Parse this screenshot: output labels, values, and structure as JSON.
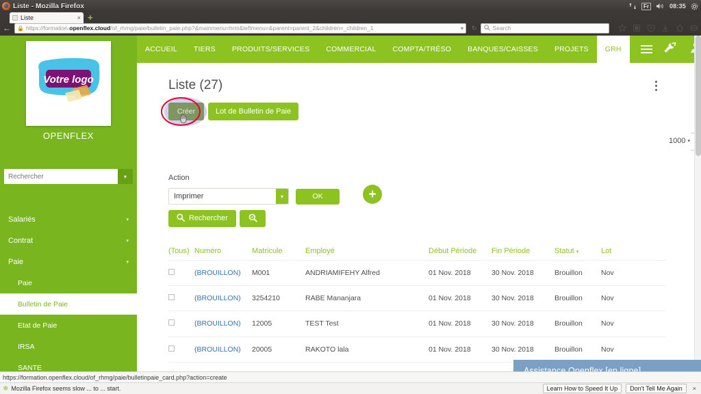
{
  "os": {
    "window_title": "Liste - Mozilla Firefox",
    "tray": {
      "network_icon": "network-icon",
      "keyboard_layout": "Fr",
      "volume_icon": "volume-icon",
      "clock": "08:35",
      "settings_icon": "gear-icon"
    }
  },
  "browser": {
    "tab": {
      "title": "Liste",
      "close_label": "×",
      "favicon": "page-icon"
    },
    "new_tab_label": "+",
    "back_label": "←",
    "url": {
      "lock_icon": "lock-icon",
      "prefix": "https://formation.",
      "domain": "openflex.cloud",
      "path": "/of_rhmg/paie/bulletin_paie.php?&mainmenu=hrm&leftmenu=&parent=parent_2&children=_children_1",
      "dropdown_label": "▾",
      "reload_label": "↻"
    },
    "search": {
      "placeholder": "Search",
      "icon": "search-icon"
    },
    "toolbar_icons": [
      "bookmark-star-icon",
      "library-icon",
      "pocket-icon",
      "downloads-icon",
      "home-icon",
      "account-icon",
      "hamburger-menu-icon"
    ]
  },
  "sidebar": {
    "logo": {
      "alt": "Votre logo",
      "text": "Votre logo"
    },
    "brand": "OPENFLEX",
    "search": {
      "placeholder": "Rechercher",
      "value": "",
      "button_icon": "chevron-down-icon"
    },
    "items": [
      {
        "label": "Salariés",
        "caret": "▾",
        "type": "group",
        "active": false
      },
      {
        "label": "Contrat",
        "caret": "▾",
        "type": "group",
        "active": false
      },
      {
        "label": "Paie",
        "caret": "▾",
        "type": "group",
        "active": false
      },
      {
        "label": "Paie",
        "type": "sub",
        "active": false
      },
      {
        "label": "Bulletin de Paie",
        "type": "sub",
        "active": true
      },
      {
        "label": "Etat de Paie",
        "type": "sub",
        "active": false
      },
      {
        "label": "IRSA",
        "type": "sub",
        "active": false
      },
      {
        "label": "SANTE",
        "type": "sub",
        "active": false
      }
    ]
  },
  "topnav": {
    "items": [
      {
        "label": "ACCUEIL",
        "active": false
      },
      {
        "label": "TIERS",
        "active": false
      },
      {
        "label": "PRODUITS/SERVICES",
        "active": false
      },
      {
        "label": "COMMERCIAL",
        "active": false
      },
      {
        "label": "COMPTA/TRÉSO",
        "active": false
      },
      {
        "label": "BANQUES/CAISSES",
        "active": false
      },
      {
        "label": "PROJETS",
        "active": false
      },
      {
        "label": "GRH",
        "active": true
      }
    ],
    "icons": [
      "hamburger-menu-icon",
      "tools-icon",
      "user-icon",
      "printer-icon",
      "power-icon"
    ]
  },
  "main": {
    "title": "Liste (27)",
    "kebab_label": "more-options",
    "buttons": {
      "creer": "Créer",
      "lot": "Lot de Bulletin de Paie"
    },
    "limit_select": {
      "value": "1000",
      "caret": "▾"
    },
    "action": {
      "label": "Action",
      "select_value": "Imprimer",
      "select_caret": "▾",
      "ok_label": "OK",
      "add_label": "+"
    },
    "search": {
      "rechercher_label": "Rechercher",
      "rechercher_icon": "search-icon",
      "reset_icon": "search-minus-icon"
    },
    "table": {
      "columns": [
        {
          "key": "check",
          "label": "(Tous)"
        },
        {
          "key": "numero",
          "label": "Numéro"
        },
        {
          "key": "matricule",
          "label": "Matricule"
        },
        {
          "key": "employe",
          "label": "Employé"
        },
        {
          "key": "debut",
          "label": "Début Période"
        },
        {
          "key": "fin",
          "label": "Fin Période"
        },
        {
          "key": "statut",
          "label": "Statut",
          "sorted": true,
          "caret": "▾"
        },
        {
          "key": "lot",
          "label": "Lot"
        }
      ],
      "rows": [
        {
          "numero": "(BROUILLON)",
          "matricule": "M001",
          "employe": "ANDRIAMIFEHY Alfred",
          "debut": "01 Nov. 2018",
          "fin": "30 Nov. 2018",
          "statut": "Brouillon",
          "lot": "Nov"
        },
        {
          "numero": "(BROUILLON)",
          "matricule": "3254210",
          "employe": "RABE Mananjara",
          "debut": "01 Nov. 2018",
          "fin": "30 Nov. 2018",
          "statut": "Brouillon",
          "lot": "Nov"
        },
        {
          "numero": "(BROUILLON)",
          "matricule": "12005",
          "employe": "TEST Test",
          "debut": "01 Nov. 2018",
          "fin": "30 Nov. 2018",
          "statut": "Brouillon",
          "lot": "Nov"
        },
        {
          "numero": "(BROUILLON)",
          "matricule": "20005",
          "employe": "RAKOTO lala",
          "debut": "01 Nov. 2018",
          "fin": "30 Nov. 2018",
          "statut": "Brouillon",
          "lot": "Nov"
        }
      ]
    }
  },
  "chat_widget": {
    "label": "Assistance Openflex [en ligne]"
  },
  "status": {
    "link": "https://formation.openflex.cloud/of_rhmg/paie/bulletinpaie_card.php?action=create"
  },
  "notification": {
    "icon": "firefox-icon",
    "message": "Mozilla Firefox seems slow ... to ... start.",
    "speed_button": "Learn How to Speed It Up",
    "dismiss_button": "Don't Tell Me Again",
    "close_label": "×"
  },
  "colors": {
    "brand_green": "#8cc321",
    "sidebar_green": "#79b51f",
    "link_blue": "#3572b0",
    "highlight_red": "#e8002a",
    "chat_blue": "#7ba0c4"
  }
}
